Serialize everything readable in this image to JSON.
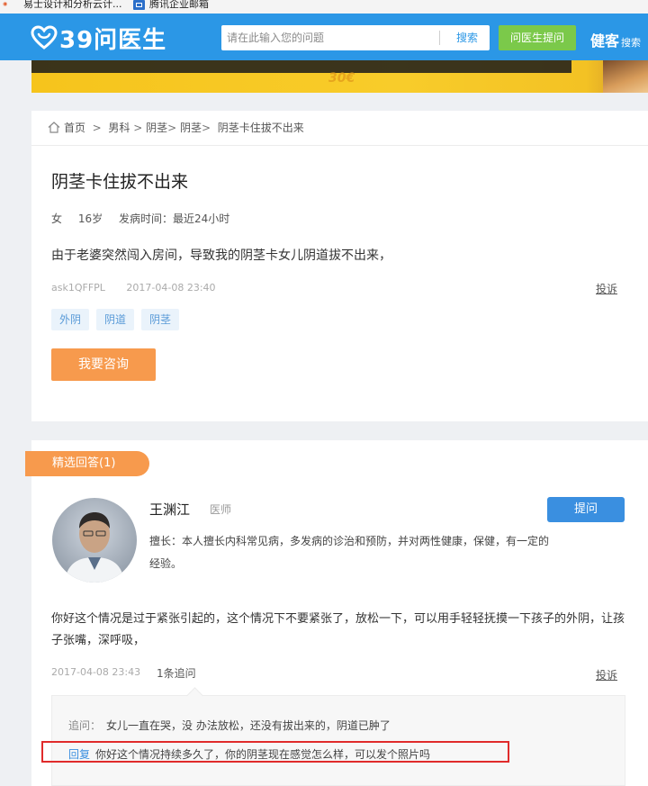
{
  "bookmarks": [
    {
      "label": "易士设计和分析云计..."
    },
    {
      "label": "腾讯企业邮箱"
    }
  ],
  "header": {
    "logo_text": "39问医生",
    "search_placeholder": "请在此输入您的问题",
    "search_button": "搜索",
    "ask_button": "问医生提问",
    "brand_right": "健客",
    "brand_right_sub": "搜索"
  },
  "banner": {
    "sub_text": "30€"
  },
  "breadcrumb": {
    "items": [
      "首页",
      "男科",
      "阴茎",
      "阴茎",
      "阴茎卡住拔不出来"
    ],
    "seps": [
      ">",
      ">",
      ">"
    ]
  },
  "question": {
    "title": "阴茎卡住拔不出来",
    "gender": "女",
    "age": "16岁",
    "onset": "发病时间：最近24小时",
    "body": "由于老婆突然闯入房间，导致我的阴茎卡女儿阴道拔不出来，",
    "user": "ask1QFFPL",
    "time": "2017-04-08 23:40",
    "report": "投诉",
    "tags": [
      "外阴",
      "阴道",
      "阴茎"
    ],
    "consult_button": "我要咨询"
  },
  "answers": {
    "ribbon": "精选回答(1)",
    "doctor": {
      "name": "王渊江",
      "title": "医师",
      "specialty": "擅长：本人擅长内科常见病，多发病的诊治和预防，并对两性健康，保健，有一定的经验。",
      "ask_button": "提问"
    },
    "body": "你好这个情况是过于紧张引起的，这个情况下不要紧张了，放松一下，可以用手轻轻抚摸一下孩子的外阴，让孩子张嘴，深呼吸，",
    "time": "2017-04-08 23:43",
    "follow_count": "1条追问",
    "report": "投诉",
    "followup": {
      "q_label": "追问：",
      "q_text": "女儿一直在哭，没 办法放松，还没有拔出来的，阴道已肿了",
      "r_label": "回复",
      "r_text": "你好这个情况持续多久了，你的阴茎现在感觉怎么样，可以发个照片吗"
    }
  },
  "colors": {
    "brand_blue": "#2b97e6",
    "ask_green": "#7bc94a",
    "orange": "#f79a4d",
    "highlight_red": "#e02b2b"
  }
}
